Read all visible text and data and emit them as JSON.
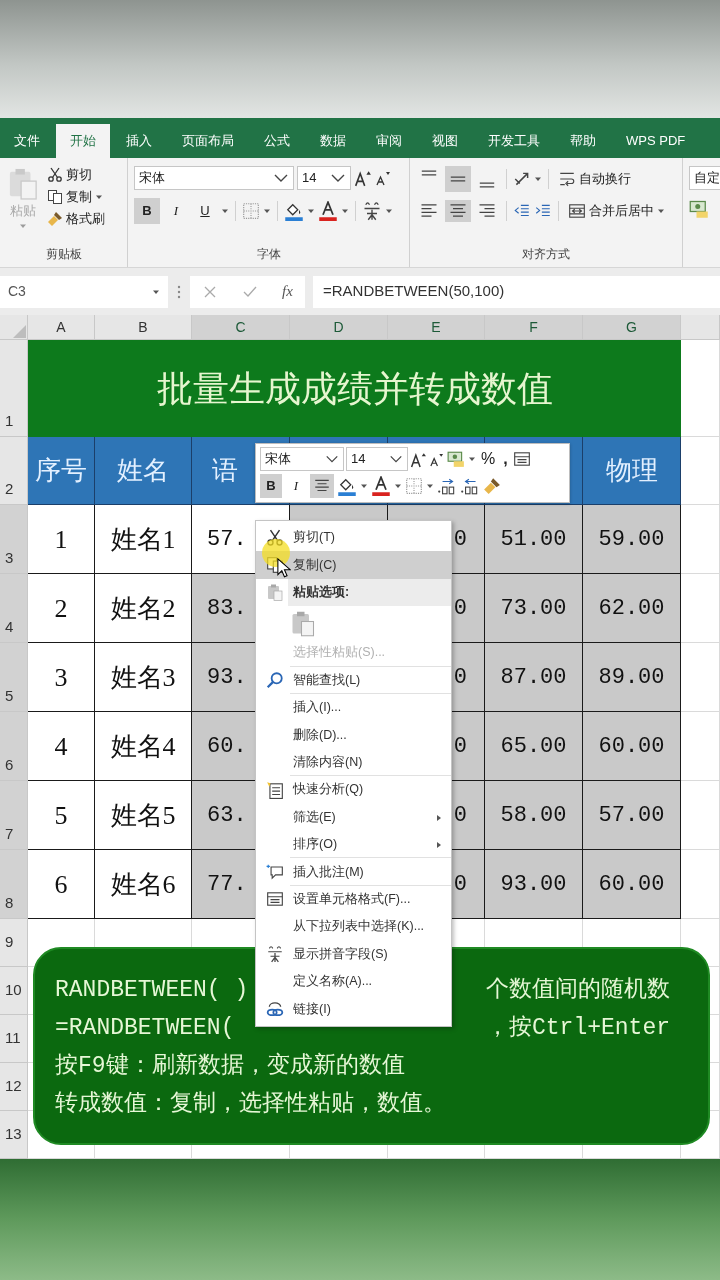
{
  "ribbon": {
    "tabs": [
      {
        "label": "文件",
        "selected": false
      },
      {
        "label": "开始",
        "selected": true
      },
      {
        "label": "插入",
        "selected": false
      },
      {
        "label": "页面布局",
        "selected": false
      },
      {
        "label": "公式",
        "selected": false
      },
      {
        "label": "数据",
        "selected": false
      },
      {
        "label": "审阅",
        "selected": false
      },
      {
        "label": "视图",
        "selected": false
      },
      {
        "label": "开发工具",
        "selected": false
      },
      {
        "label": "帮助",
        "selected": false
      },
      {
        "label": "WPS PDF",
        "selected": false
      }
    ],
    "clipboard": {
      "paste": "粘贴",
      "paste_disabled": true,
      "cut": "剪切",
      "copy": "复制",
      "format_painter": "格式刷",
      "label": "剪贴板"
    },
    "font": {
      "name": "宋体",
      "size": "14",
      "bold": {
        "label": "B",
        "on": true
      },
      "italic": {
        "label": "I",
        "on": false
      },
      "underline": {
        "label": "U",
        "on": false
      },
      "label": "字体"
    },
    "alignment": {
      "middle_on": true,
      "center_on": true,
      "wrap_text": "自动换行",
      "merge_center": "合并后居中",
      "label": "对齐方式"
    },
    "number_format": "自定"
  },
  "formula_bar": {
    "name_box": "C3",
    "fx": "fx",
    "formula": "=RANDBETWEEN(50,100)"
  },
  "sheet": {
    "column_headers": [
      {
        "label": "A",
        "selected": false
      },
      {
        "label": "B",
        "selected": false
      },
      {
        "label": "C",
        "selected": true
      },
      {
        "label": "D",
        "selected": true
      },
      {
        "label": "E",
        "selected": true
      },
      {
        "label": "F",
        "selected": true
      },
      {
        "label": "G",
        "selected": true
      }
    ],
    "row_headers": [
      {
        "label": "1",
        "selected": false
      },
      {
        "label": "2",
        "selected": false
      },
      {
        "label": "3",
        "selected": true
      },
      {
        "label": "4",
        "selected": true
      },
      {
        "label": "5",
        "selected": true
      },
      {
        "label": "6",
        "selected": true
      },
      {
        "label": "7",
        "selected": true
      },
      {
        "label": "8",
        "selected": true
      },
      {
        "label": "9",
        "selected": false
      },
      {
        "label": "10",
        "selected": false
      },
      {
        "label": "11",
        "selected": false
      },
      {
        "label": "12",
        "selected": false
      },
      {
        "label": "13",
        "selected": false
      }
    ],
    "title": "批量生成成绩并转成数值",
    "header_cells": [
      {
        "text": "序号"
      },
      {
        "text": "姓名"
      },
      {
        "text": "语"
      },
      {},
      {},
      {},
      {
        "text": "物理"
      }
    ],
    "data_rows": [
      {
        "cells": [
          {
            "text": "1",
            "selected": false
          },
          {
            "text": "姓名1",
            "selected": false
          },
          {
            "text": "57.",
            "selected": false
          },
          {
            "selected": true
          },
          {
            "text": "0",
            "selected": true
          },
          {
            "text": "51.00",
            "selected": true
          },
          {
            "text": "59.00",
            "selected": true
          }
        ]
      },
      {
        "cells": [
          {
            "text": "2",
            "selected": false
          },
          {
            "text": "姓名2",
            "selected": false
          },
          {
            "text": "83.",
            "selected": true
          },
          {},
          {
            "text": "0",
            "selected": true
          },
          {
            "text": "73.00",
            "selected": true
          },
          {
            "text": "62.00",
            "selected": true
          }
        ]
      },
      {
        "cells": [
          {
            "text": "3",
            "selected": false
          },
          {
            "text": "姓名3",
            "selected": false
          },
          {
            "text": "93.",
            "selected": true
          },
          {},
          {
            "text": "0",
            "selected": true
          },
          {
            "text": "87.00",
            "selected": true
          },
          {
            "text": "89.00",
            "selected": true
          }
        ]
      },
      {
        "cells": [
          {
            "text": "4",
            "selected": false
          },
          {
            "text": "姓名4",
            "selected": false
          },
          {
            "text": "60.",
            "selected": true
          },
          {},
          {
            "text": "0",
            "selected": true
          },
          {
            "text": "65.00",
            "selected": true
          },
          {
            "text": "60.00",
            "selected": true
          }
        ]
      },
      {
        "cells": [
          {
            "text": "5",
            "selected": false
          },
          {
            "text": "姓名5",
            "selected": false
          },
          {
            "text": "63.",
            "selected": true
          },
          {},
          {
            "text": "0",
            "selected": true
          },
          {
            "text": "58.00",
            "selected": true
          },
          {
            "text": "57.00",
            "selected": true
          }
        ]
      },
      {
        "cells": [
          {
            "text": "6",
            "selected": false
          },
          {
            "text": "姓名6",
            "selected": false
          },
          {
            "text": "77.",
            "selected": true
          },
          {},
          {
            "text": "0",
            "selected": true
          },
          {
            "text": "93.00",
            "selected": true
          },
          {
            "text": "60.00",
            "selected": true
          }
        ]
      }
    ]
  },
  "mini_toolbar": {
    "font": "宋体",
    "size": "14",
    "percent": "%",
    "comma": ",",
    "bold": {
      "label": "B",
      "on": true
    },
    "italic": {
      "label": "I",
      "on": false
    },
    "center_on": true
  },
  "context_menu": {
    "items": [
      {
        "kind": "item",
        "label": "剪切(T)",
        "selected": false,
        "disabled": false,
        "separator_after": false
      },
      {
        "kind": "item",
        "label": "复制(C)",
        "selected": true,
        "disabled": false,
        "separator_after": false
      },
      {
        "kind": "header",
        "label": "粘贴选项:",
        "disabled": false
      },
      {
        "kind": "paste_button",
        "selected": false,
        "disabled": false
      },
      {
        "kind": "item",
        "label": "选择性粘贴(S)...",
        "selected": false,
        "disabled": true,
        "separator_after": true
      },
      {
        "kind": "item",
        "label": "智能查找(L)",
        "selected": false,
        "disabled": false,
        "separator_after": true
      },
      {
        "kind": "item",
        "label": "插入(I)...",
        "selected": false,
        "disabled": false,
        "separator_after": false
      },
      {
        "kind": "item",
        "label": "删除(D)...",
        "selected": false,
        "disabled": false,
        "separator_after": false
      },
      {
        "kind": "item",
        "label": "清除内容(N)",
        "selected": false,
        "disabled": false,
        "separator_after": true
      },
      {
        "kind": "item",
        "label": "快速分析(Q)",
        "selected": false,
        "disabled": false,
        "separator_after": false
      },
      {
        "kind": "submenu",
        "label": "筛选(E)",
        "selected": false,
        "disabled": false,
        "separator_after": false
      },
      {
        "kind": "submenu",
        "label": "排序(O)",
        "selected": false,
        "disabled": false,
        "separator_after": true
      },
      {
        "kind": "item",
        "label": "插入批注(M)",
        "selected": false,
        "disabled": false,
        "separator_after": true
      },
      {
        "kind": "item",
        "label": "设置单元格格式(F)...",
        "selected": false,
        "disabled": false,
        "separator_after": false
      },
      {
        "kind": "item",
        "label": "从下拉列表中选择(K)...",
        "selected": false,
        "disabled": false,
        "separator_after": false
      },
      {
        "kind": "item",
        "label": "显示拼音字段(S)",
        "selected": false,
        "disabled": false,
        "separator_after": false
      },
      {
        "kind": "item",
        "label": "定义名称(A)...",
        "selected": false,
        "disabled": false,
        "separator_after": false
      },
      {
        "kind": "item",
        "label": "链接(I)",
        "selected": false,
        "disabled": false,
        "separator_after": false
      }
    ]
  },
  "note": {
    "lines": [
      {
        "segments": [
          "RANDBETWEEN( )",
          "个数值间的随机数"
        ]
      },
      {
        "segments": [
          "=RANDBETWEEN(",
          "，按Ctrl+Enter"
        ]
      },
      {
        "segments": [
          "按F9键：刷新数据，变成新的数值"
        ]
      },
      {
        "segments": [
          "转成数值：复制，选择性粘贴，数值。"
        ]
      }
    ]
  }
}
